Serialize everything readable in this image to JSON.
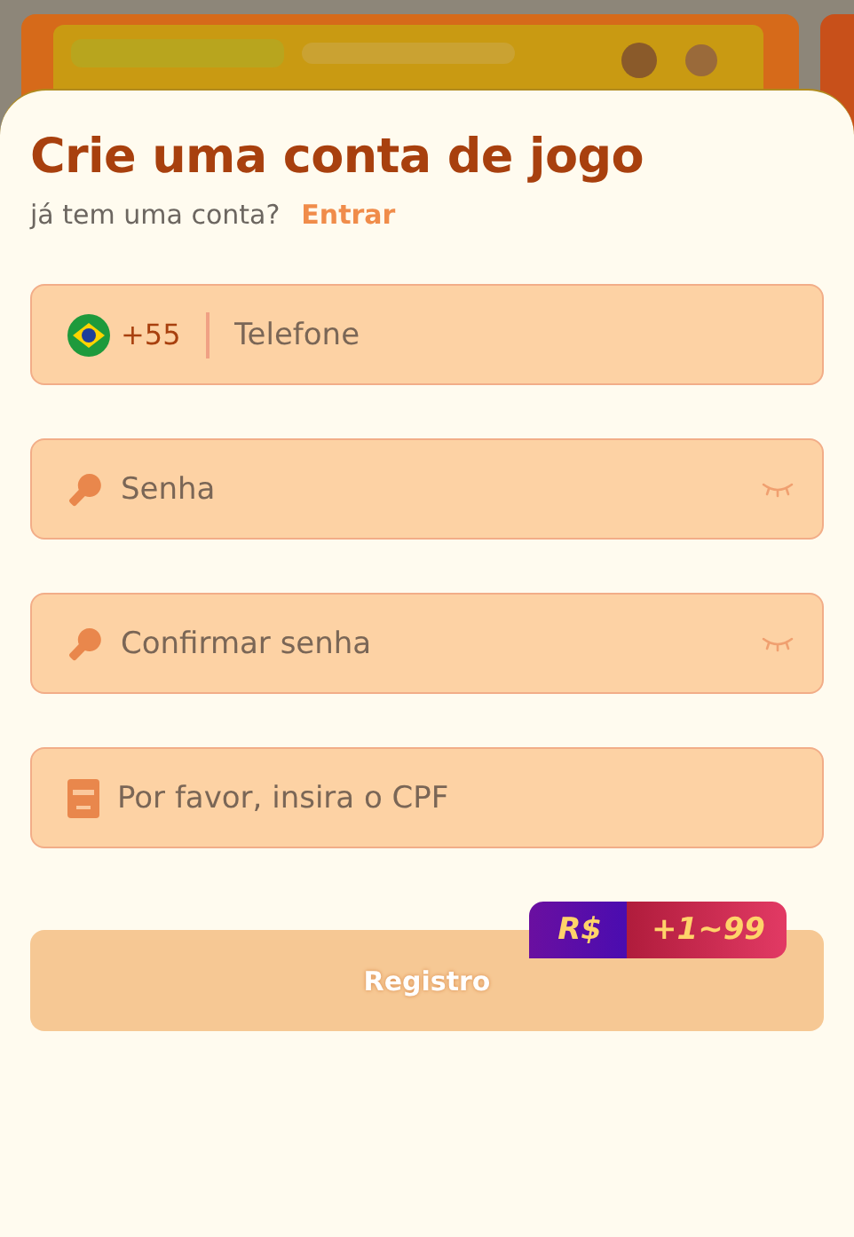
{
  "title": "Crie uma conta de jogo",
  "login_prompt": {
    "text": "já tem uma conta?",
    "link": "Entrar"
  },
  "fields": [
    {
      "kind": "phone",
      "country_code": "+55",
      "placeholder": "Telefone"
    },
    {
      "kind": "password",
      "placeholder": "Senha"
    },
    {
      "kind": "password",
      "placeholder": "Confirmar senha"
    },
    {
      "kind": "cpf",
      "placeholder": "Por favor, insira o CPF"
    }
  ],
  "submit": {
    "label": "Registro",
    "disabled": true
  },
  "bonus_badge": {
    "currency": "R$",
    "amount": "+1~99"
  }
}
